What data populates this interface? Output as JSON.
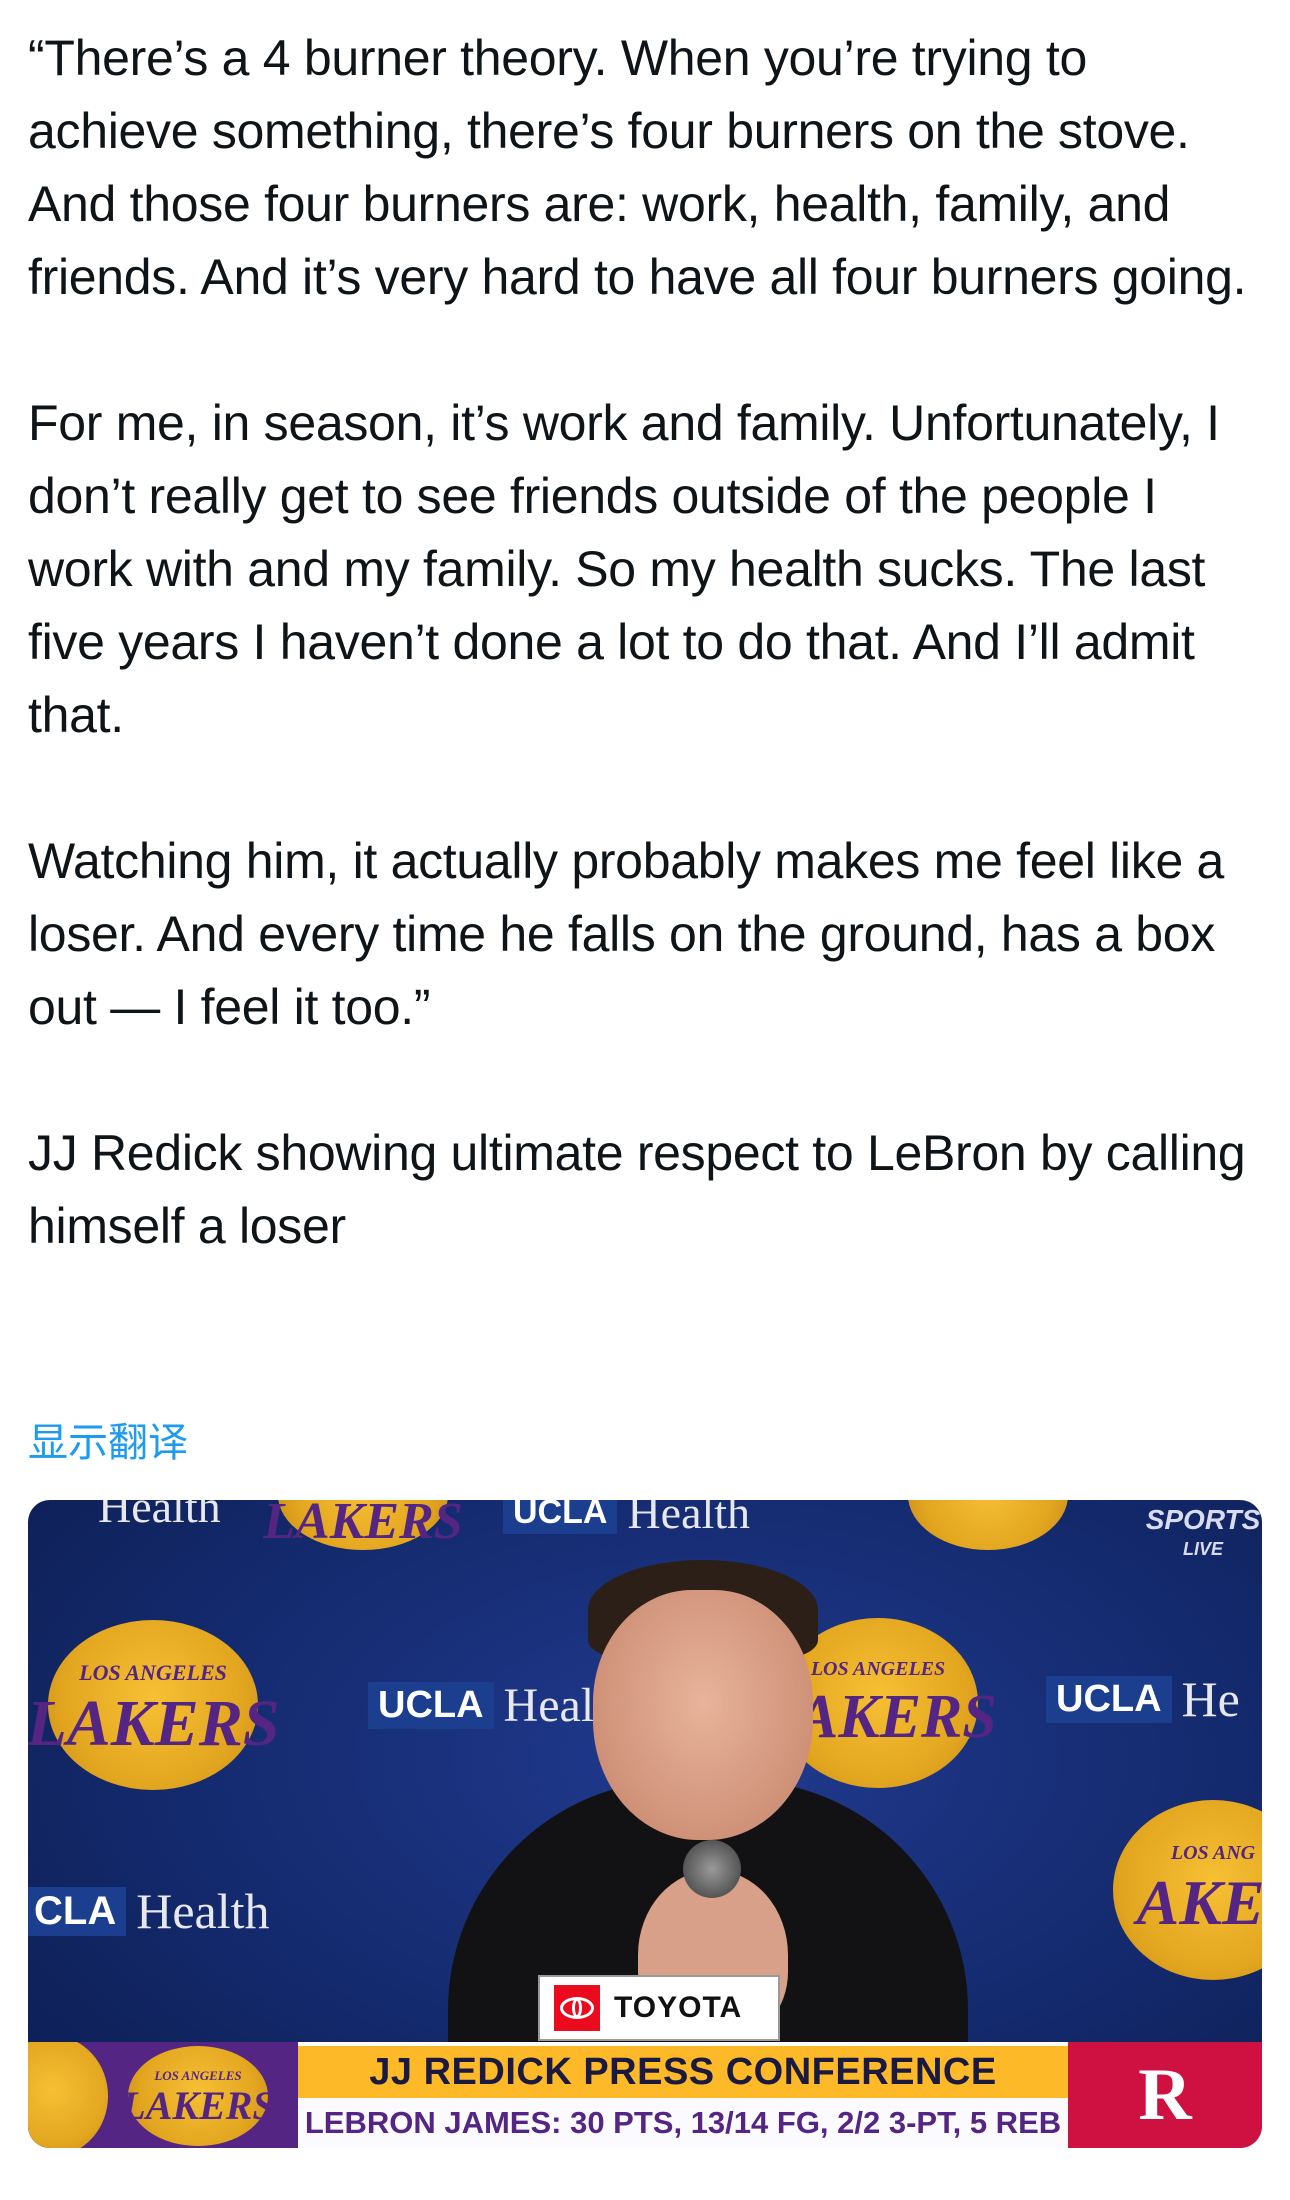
{
  "tweet": {
    "paragraphs": [
      "“There’s a 4 burner theory. When you’re trying to achieve something, there’s four burners on the stove. And those four burners are: work, health, family, and friends. And it’s very hard to have all four burners going.",
      "For me, in season, it’s work and family. Unfortunately, I don’t really get to see friends outside of the people I work with and my family. So my health sucks. The last five years I haven’t done a lot to do that. And I’ll admit that.",
      "Watching him, it actually probably makes me feel like a loser. And every time he falls on the ground, has a box out — I feel it too.”",
      "JJ Redick showing ultimate respect to LeBron by calling himself a loser"
    ],
    "translate_label": "显示翻译"
  },
  "media": {
    "backdrop": {
      "team_wordmark": "LAKERS",
      "team_city": "LOS ANGELES",
      "sponsor_ucla": "UCLA",
      "sponsor_health": "Health",
      "sponsor_health_partial": "Heal",
      "sponsor_health_he": "He",
      "team_partial": "AKEI",
      "city_partial": "LOS ANG",
      "sponsor_ucla_partial": "CLA"
    },
    "broadcast_bug": {
      "line1": "SPORTS",
      "line2": "LIVE"
    },
    "podium_sign": {
      "brand": "TOYOTA",
      "icon": "toyota-logo-icon"
    },
    "lower_third": {
      "title": "JJ REDICK PRESS CONFERENCE",
      "stat_line": "LEBRON JAMES: 30 PTS, 13/14 FG, 2/2 3-PT, 5 REB",
      "left_logo": "LAKERS",
      "left_logo_city": "LOS ANGELES",
      "right_logo_icon": "rockets-logo-icon",
      "right_logo_glyph": "R",
      "colors": {
        "lakers_purple": "#552583",
        "lakers_gold": "#fdb927",
        "rockets_red": "#ce1141"
      }
    }
  }
}
